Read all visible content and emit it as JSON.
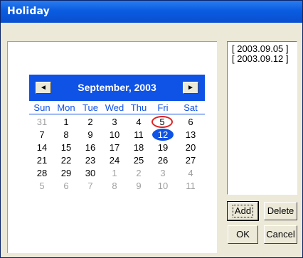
{
  "window": {
    "title": "Holiday"
  },
  "calendar": {
    "month_label": "September, 2003",
    "prev_icon": "◄",
    "next_icon": "►",
    "weekdays": [
      "Sun",
      "Mon",
      "Tue",
      "Wed",
      "Thu",
      "Fri",
      "Sat"
    ],
    "weeks": [
      [
        {
          "d": "31",
          "o": true
        },
        {
          "d": "1"
        },
        {
          "d": "2"
        },
        {
          "d": "3"
        },
        {
          "d": "4"
        },
        {
          "d": "5",
          "today": true
        },
        {
          "d": "6"
        }
      ],
      [
        {
          "d": "7"
        },
        {
          "d": "8"
        },
        {
          "d": "9"
        },
        {
          "d": "10"
        },
        {
          "d": "11"
        },
        {
          "d": "12",
          "sel": true
        },
        {
          "d": "13"
        }
      ],
      [
        {
          "d": "14"
        },
        {
          "d": "15"
        },
        {
          "d": "16"
        },
        {
          "d": "17"
        },
        {
          "d": "18"
        },
        {
          "d": "19"
        },
        {
          "d": "20"
        }
      ],
      [
        {
          "d": "21"
        },
        {
          "d": "22"
        },
        {
          "d": "23"
        },
        {
          "d": "24"
        },
        {
          "d": "25"
        },
        {
          "d": "26"
        },
        {
          "d": "27"
        }
      ],
      [
        {
          "d": "28"
        },
        {
          "d": "29"
        },
        {
          "d": "30"
        },
        {
          "d": "1",
          "o": true
        },
        {
          "d": "2",
          "o": true
        },
        {
          "d": "3",
          "o": true
        },
        {
          "d": "4",
          "o": true
        }
      ],
      [
        {
          "d": "5",
          "o": true
        },
        {
          "d": "6",
          "o": true
        },
        {
          "d": "7",
          "o": true
        },
        {
          "d": "8",
          "o": true
        },
        {
          "d": "9",
          "o": true
        },
        {
          "d": "10",
          "o": true
        },
        {
          "d": "11",
          "o": true
        }
      ]
    ],
    "colors": {
      "header": "#0f52e6",
      "today_ring": "#e02020",
      "other_month": "#a0a0a0"
    }
  },
  "holiday_list": {
    "items": [
      "[ 2003.09.05 ]",
      "[ 2003.09.12 ]"
    ]
  },
  "buttons": {
    "add": "Add",
    "delete": "Delete",
    "ok": "OK",
    "cancel": "Cancel"
  }
}
